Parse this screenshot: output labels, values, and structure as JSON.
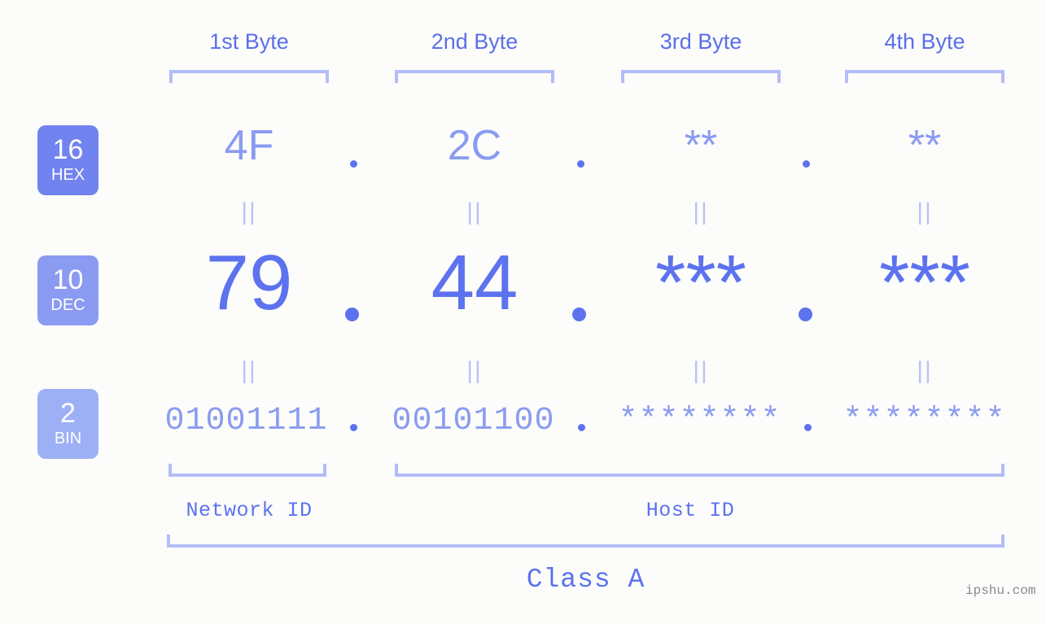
{
  "meta": {
    "background_color": "#fcfdfa",
    "accent_color": "#5c72ef",
    "accent_light_color": "#8a9bf0",
    "bracket_color": "#b3bdf7",
    "watermark": "ipshu.com"
  },
  "headers": [
    {
      "label": "1st Byte"
    },
    {
      "label": "2nd Byte"
    },
    {
      "label": "3rd Byte"
    },
    {
      "label": "4th Byte"
    }
  ],
  "bases": [
    {
      "number": "16",
      "abbr": "HEX",
      "color": "#7183ef"
    },
    {
      "number": "10",
      "abbr": "DEC",
      "color": "#8b9bf2"
    },
    {
      "number": "2",
      "abbr": "BIN",
      "color": "#9db0f6"
    }
  ],
  "rows": {
    "hex": {
      "values": [
        "4F",
        "2C",
        "**",
        "**"
      ]
    },
    "dec": {
      "values": [
        "79",
        "44",
        "***",
        "***"
      ]
    },
    "binary": {
      "values": [
        "01001111",
        "00101100",
        "********",
        "********"
      ]
    }
  },
  "separators": {
    "hex_dot": ".",
    "dec_dot": ".",
    "bin_dot": "."
  },
  "connectors": {
    "symbol": "||"
  },
  "segments": {
    "network_id": "Network ID",
    "host_id": "Host ID"
  },
  "class": {
    "label": "Class A"
  }
}
